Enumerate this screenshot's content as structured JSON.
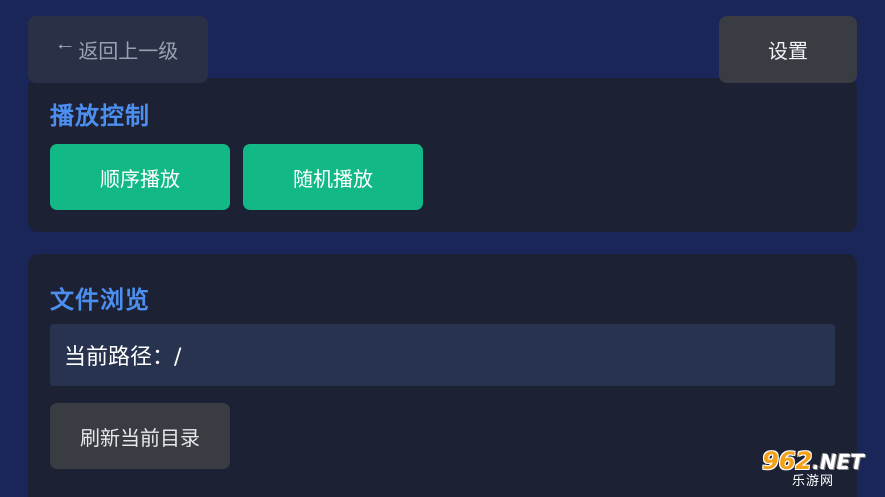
{
  "topbar": {
    "back_icon": "arrow-left-icon",
    "back_label": "返回上一级",
    "settings_label": "设置"
  },
  "playback": {
    "title": "播放控制",
    "sequential_label": "顺序播放",
    "shuffle_label": "随机播放"
  },
  "files": {
    "title": "文件浏览",
    "path_text": "当前路径：/",
    "refresh_label": "刷新当前目录"
  },
  "watermark": {
    "main": "962",
    "suffix": ".NET",
    "sub": "乐游网"
  },
  "colors": {
    "background": "#1a2558",
    "panel": "#1c2234",
    "accent_title": "#4c8ff0",
    "green_button": "#12b886",
    "dark_button": "#3a3c43",
    "path_box": "#283350"
  }
}
